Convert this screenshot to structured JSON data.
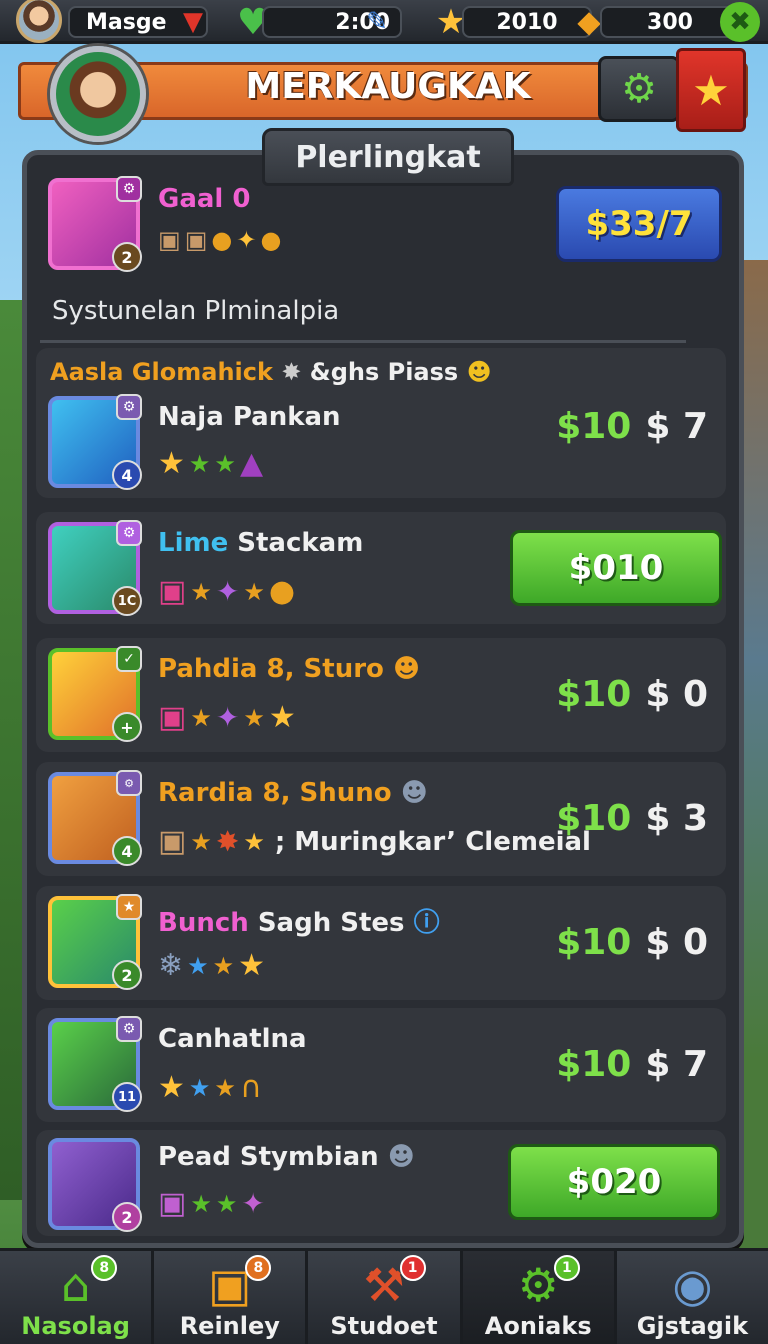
{
  "topbar": {
    "player_name": "Masge",
    "resource_1": "2:00",
    "resource_2": "2010",
    "resource_3": "300"
  },
  "header": {
    "title": "MERKAUGKAK"
  },
  "panel": {
    "tab_title": "Plerlingkat",
    "player": {
      "name": "Gaal 0",
      "level": "2",
      "price_button": "$33/7"
    },
    "section_title": "Systunelan Plminalpia",
    "group_label": "Aasla Glomahick",
    "group_label_2": "&ghs Piass",
    "cards": [
      {
        "name": "Naja Pankan",
        "level": "4",
        "price_green": "$10",
        "price_white": "$ 7"
      },
      {
        "name_a": "Lime",
        "name_b": "Stackam",
        "level": "1C",
        "button": "$010"
      },
      {
        "name": "Pahdia 8, Sturo",
        "level": "+",
        "price_green": "$10",
        "price_white": "$ 0"
      },
      {
        "name": "Rardia 8, Shuno",
        "level": "4",
        "extra": "; Muringkar’ Clemeial",
        "price_green": "$10",
        "price_white": "$ 3"
      },
      {
        "name_a": "Bunch",
        "name_b": "Sagh Stes",
        "level": "2",
        "price_green": "$10",
        "price_white": "$ 0"
      },
      {
        "name": "Canhatlna",
        "level": "11",
        "price_green": "$10",
        "price_white": "$ 7"
      },
      {
        "name": "Pead Stymbian",
        "level": "2",
        "button": "$020"
      }
    ]
  },
  "nav": {
    "tabs": [
      {
        "label": "Nasolag",
        "badge": "8"
      },
      {
        "label": "Reinley",
        "badge": "8"
      },
      {
        "label": "Studoet",
        "badge": "1"
      },
      {
        "label": "Aoniaks",
        "badge": "1"
      },
      {
        "label": "Gjstagik"
      }
    ]
  },
  "colors": {
    "accent_green": "#7ee04a",
    "accent_gold": "#ffe23a",
    "ribbon_orange": "#f08a3c",
    "panel_bg": "#2a2d33"
  }
}
